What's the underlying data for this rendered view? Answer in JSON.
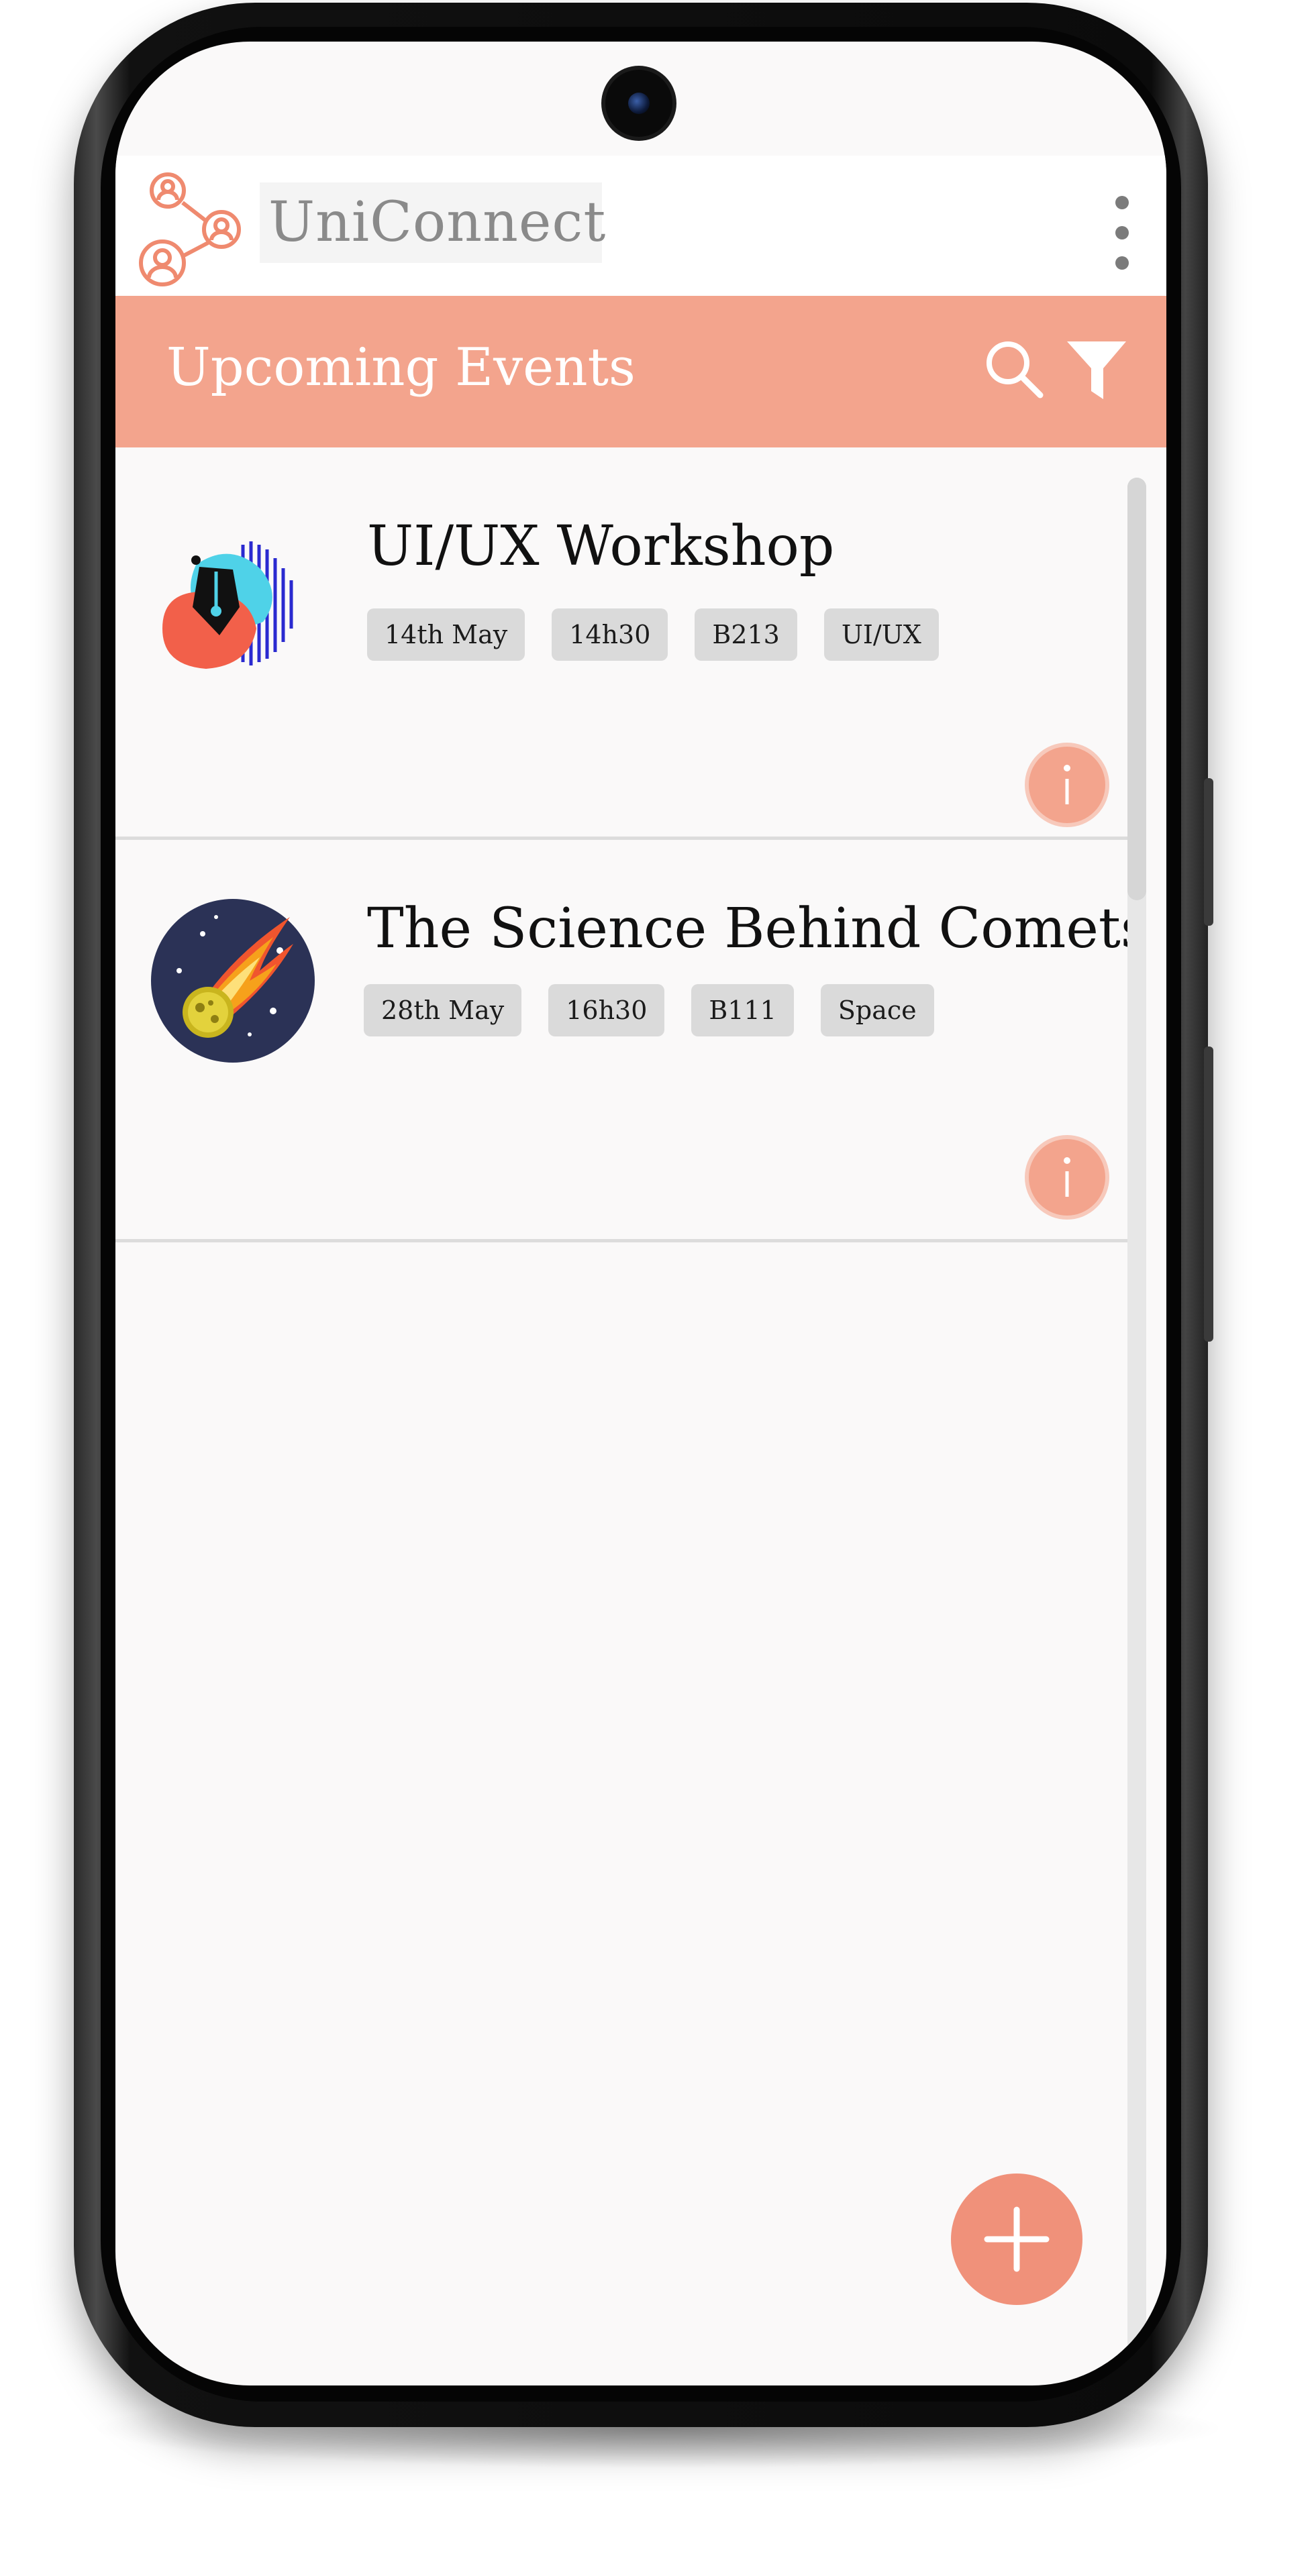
{
  "app": {
    "brand_name": "UniConnect"
  },
  "header": {
    "title": "Upcoming Events"
  },
  "events": [
    {
      "title": "UI/UX Workshop",
      "date": "14th May",
      "time": "14h30",
      "room": "B213",
      "tag": "UI/UX",
      "thumb_icon": "pen-tool-icon"
    },
    {
      "title": "The Science Behind Comets",
      "date": "28th May",
      "time": "16h30",
      "room": "B111",
      "tag": "Space",
      "thumb_icon": "comet-icon"
    }
  ],
  "colors": {
    "accent": "#f3a48d",
    "fab": "#f0917a",
    "chip_bg": "#dadada",
    "brand_text": "#8a8a8a"
  },
  "icons": {
    "search": "search-icon",
    "filter": "filter-icon",
    "info": "info-icon",
    "add": "plus-icon",
    "menu": "kebab-menu-icon",
    "logo": "network-people-icon"
  }
}
